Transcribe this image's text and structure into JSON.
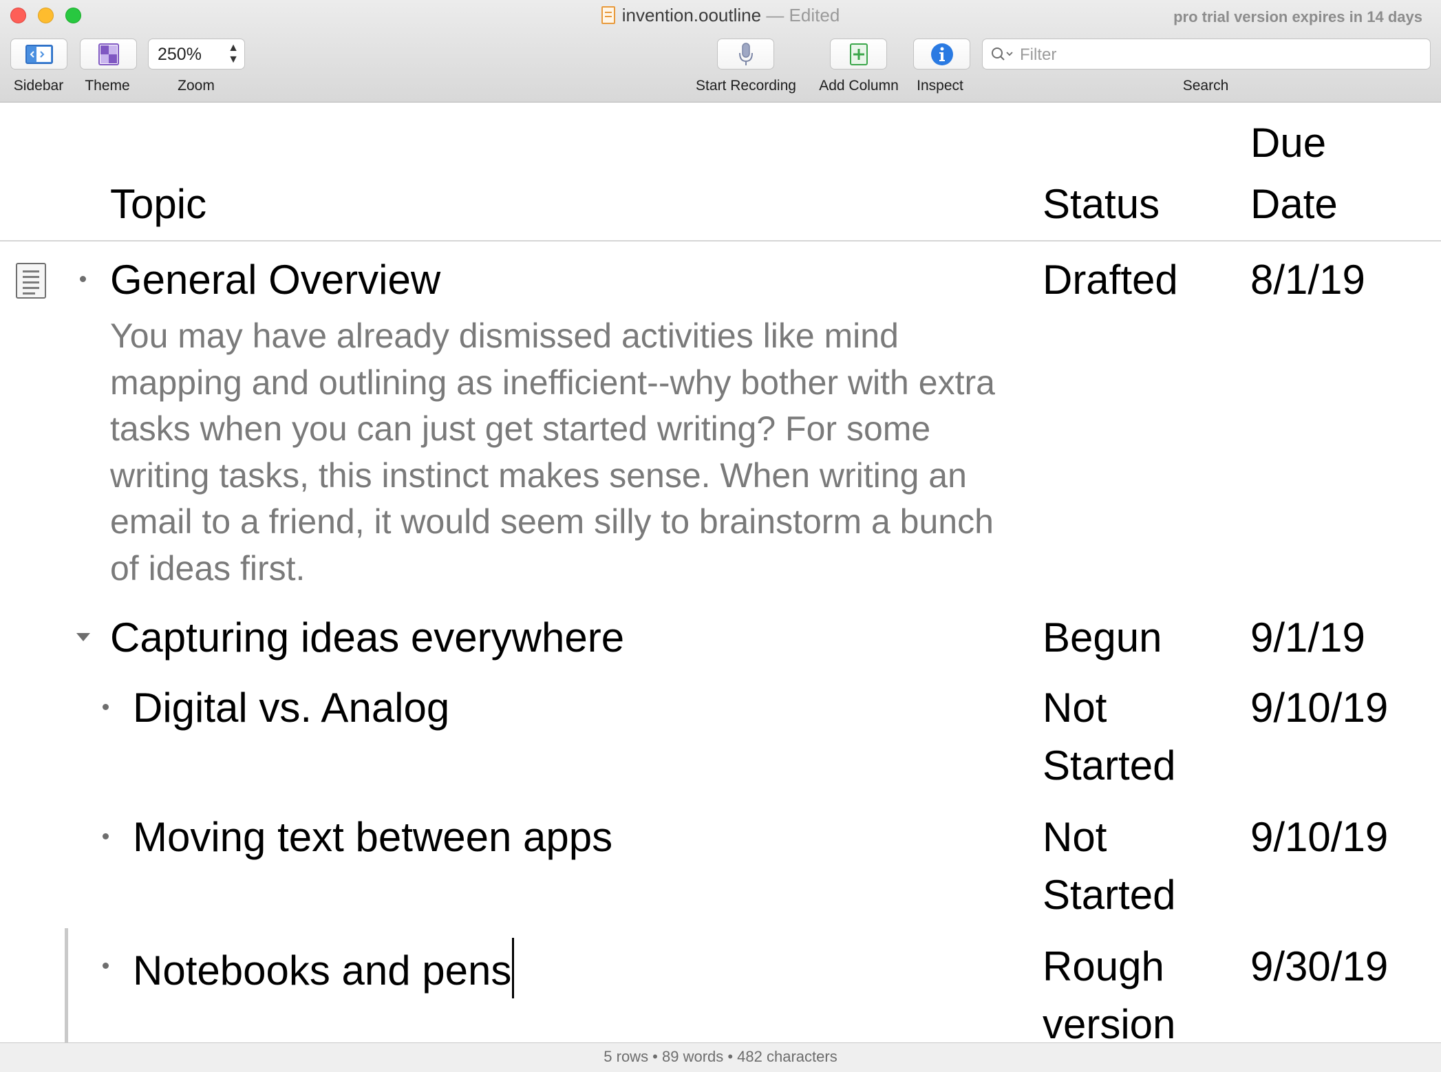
{
  "window": {
    "filename": "invention.ooutline",
    "edited_suffix": "— Edited",
    "trial_notice": "pro trial version expires in 14 days"
  },
  "toolbar": {
    "sidebar_label": "Sidebar",
    "theme_label": "Theme",
    "zoom_value": "250%",
    "zoom_label": "Zoom",
    "record_label": "Start Recording",
    "add_column_label": "Add Column",
    "inspect_label": "Inspect",
    "search_placeholder": "Filter",
    "search_label": "Search"
  },
  "columns": {
    "topic": "Topic",
    "status_header": "Status",
    "due_line1": "Due",
    "due_line2": "Date"
  },
  "rows": [
    {
      "topic": "General Overview",
      "note": "You may have already dismissed activities like mind mapping and outlining as inefficient--why bother with extra tasks when you can just get started writing? For some writing tasks, this instinct makes sense. When writing an email to a friend, it would seem silly to brainstorm a bunch of ideas first.",
      "status": "Drafted",
      "due": "8/1/19"
    },
    {
      "topic": "Capturing ideas everywhere",
      "status": "Begun",
      "due": "9/1/19",
      "expanded": true
    },
    {
      "topic": "Digital vs. Analog",
      "status": "Not Started",
      "due": "9/10/19"
    },
    {
      "topic": "Moving text between apps",
      "status": "Not Started",
      "due": "9/10/19"
    },
    {
      "topic": "Notebooks and pens",
      "status": "Rough version",
      "due": "9/30/19"
    }
  ],
  "statusbar": {
    "summary": "5 rows • 89 words • 482 characters"
  },
  "colors": {
    "close": "#fe5f57",
    "minimize": "#febc2e",
    "zoom": "#28c840",
    "note_text": "#7a7a7a",
    "inspect_blue": "#2a7ae2",
    "add_column_green": "#3aa64a",
    "theme_purple": "#7f57c2"
  },
  "icons": [
    "sidebar-icon",
    "theme-icon",
    "microphone-icon",
    "add-column-icon",
    "info-icon",
    "search-icon",
    "note-icon",
    "bullet-icon",
    "disclosure-triangle-icon"
  ]
}
